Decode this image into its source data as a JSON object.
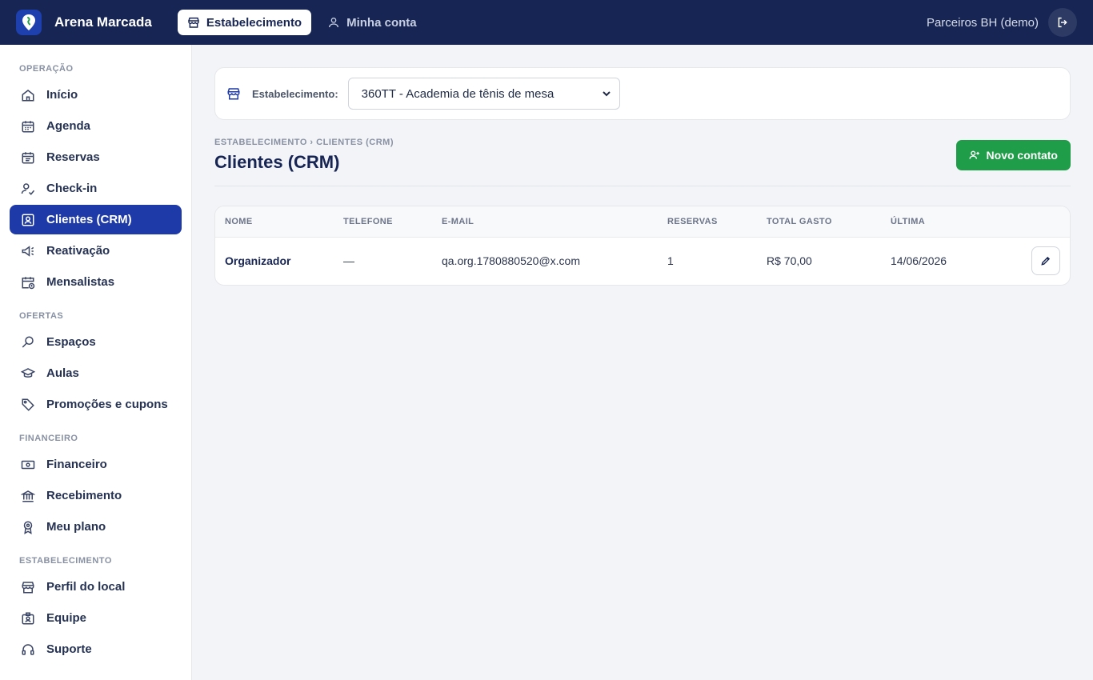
{
  "topbar": {
    "brand": "Arena Marcada",
    "tabs": [
      {
        "label": "Estabelecimento",
        "active": true
      },
      {
        "label": "Minha conta",
        "active": false
      }
    ],
    "user": "Parceiros BH (demo)"
  },
  "sidebar": {
    "sections": [
      {
        "title": "OPERAÇÃO",
        "items": [
          "Início",
          "Agenda",
          "Reservas",
          "Check-in",
          "Clientes (CRM)",
          "Reativação",
          "Mensalistas"
        ]
      },
      {
        "title": "OFERTAS",
        "items": [
          "Espaços",
          "Aulas",
          "Promoções e cupons"
        ]
      },
      {
        "title": "FINANCEIRO",
        "items": [
          "Financeiro",
          "Recebimento",
          "Meu plano"
        ]
      },
      {
        "title": "ESTABELECIMENTO",
        "items": [
          "Perfil do local",
          "Equipe",
          "Suporte"
        ]
      }
    ],
    "active_item": "Clientes (CRM)"
  },
  "establishment": {
    "label": "Estabelecimento:",
    "selected": "360TT - Academia de tênis de mesa"
  },
  "page": {
    "breadcrumb": "ESTABELECIMENTO › CLIENTES (CRM)",
    "title": "Clientes (CRM)",
    "new_contact_label": "Novo contato"
  },
  "table": {
    "headers": [
      "NOME",
      "TELEFONE",
      "E-MAIL",
      "RESERVAS",
      "TOTAL GASTO",
      "ÚLTIMA"
    ],
    "rows": [
      {
        "nome": "Organizador",
        "telefone": "—",
        "email": "qa.org.1780880520@x.com",
        "reservas": "1",
        "total": "R$ 70,00",
        "ultima": "14/06/2026"
      }
    ]
  },
  "colors": {
    "topbar": "#172554",
    "active_nav": "#1e3aa8",
    "primary_button": "#1f9d48"
  }
}
